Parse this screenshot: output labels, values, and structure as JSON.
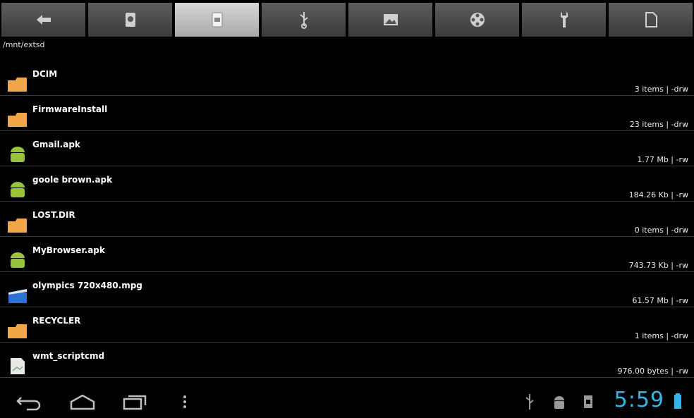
{
  "path": "/mnt/extsd",
  "toolbar": {
    "tabs": [
      {
        "icon": "back-arrow-icon"
      },
      {
        "icon": "sd-card-icon"
      },
      {
        "icon": "sd-card-active-icon"
      },
      {
        "icon": "usb-icon"
      },
      {
        "icon": "image-icon"
      },
      {
        "icon": "film-reel-icon"
      },
      {
        "icon": "wrench-icon"
      },
      {
        "icon": "document-icon"
      }
    ]
  },
  "files": [
    {
      "name": "DCIM",
      "meta": "3 items | -drw",
      "icon": "folder-icon"
    },
    {
      "name": "FirmwareInstall",
      "meta": "23 items | -drw",
      "icon": "folder-icon"
    },
    {
      "name": "Gmail.apk",
      "meta": "1.77 Mb | -rw",
      "icon": "android-icon"
    },
    {
      "name": "goole brown.apk",
      "meta": "184.26 Kb | -rw",
      "icon": "android-icon"
    },
    {
      "name": "LOST.DIR",
      "meta": "0 items | -drw",
      "icon": "folder-icon"
    },
    {
      "name": "MyBrowser.apk",
      "meta": "743.73 Kb | -rw",
      "icon": "android-icon"
    },
    {
      "name": "olympics 720x480.mpg",
      "meta": "61.57 Mb | -rw",
      "icon": "video-file-icon"
    },
    {
      "name": "RECYCLER",
      "meta": "1 items | -drw",
      "icon": "folder-icon"
    },
    {
      "name": "wmt_scriptcmd",
      "meta": "976.00 bytes | -rw",
      "icon": "text-file-icon"
    }
  ],
  "statusbar": {
    "time": "5:59"
  },
  "colors": {
    "accent": "#33b5e5",
    "folder": "#f0a646",
    "android": "#97c43c"
  }
}
